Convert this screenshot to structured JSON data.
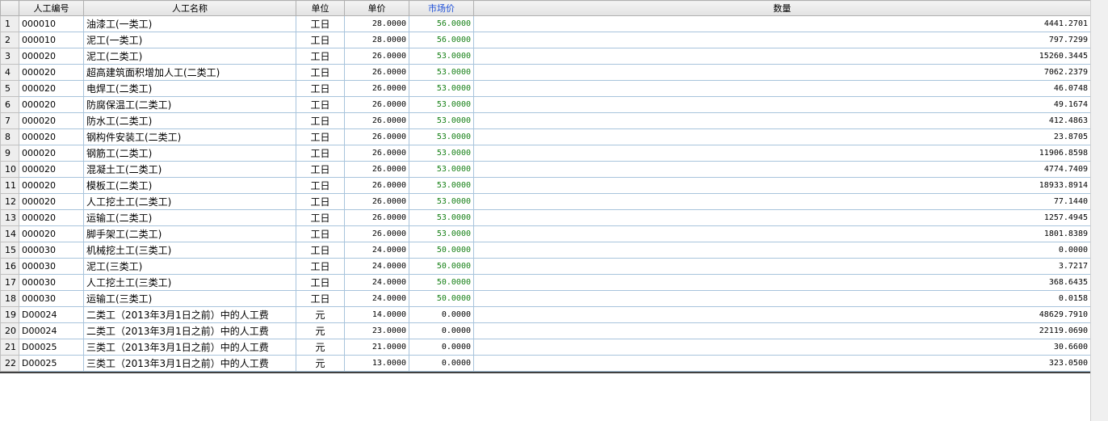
{
  "columns": {
    "rownum": "",
    "code": "人工编号",
    "name": "人工名称",
    "unit": "单位",
    "price": "单价",
    "market_price": "市场价",
    "quantity": "数量"
  },
  "rows": [
    {
      "n": "1",
      "code": "000010",
      "name": "油漆工(一类工)",
      "unit": "工日",
      "price": "28.0000",
      "market": "56.0000",
      "qty": "4441.2701"
    },
    {
      "n": "2",
      "code": "000010",
      "name": "泥工(一类工)",
      "unit": "工日",
      "price": "28.0000",
      "market": "56.0000",
      "qty": "797.7299"
    },
    {
      "n": "3",
      "code": "000020",
      "name": "泥工(二类工)",
      "unit": "工日",
      "price": "26.0000",
      "market": "53.0000",
      "qty": "15260.3445"
    },
    {
      "n": "4",
      "code": "000020",
      "name": "超高建筑面积增加人工(二类工)",
      "unit": "工日",
      "price": "26.0000",
      "market": "53.0000",
      "qty": "7062.2379"
    },
    {
      "n": "5",
      "code": "000020",
      "name": "电焊工(二类工)",
      "unit": "工日",
      "price": "26.0000",
      "market": "53.0000",
      "qty": "46.0748"
    },
    {
      "n": "6",
      "code": "000020",
      "name": "防腐保温工(二类工)",
      "unit": "工日",
      "price": "26.0000",
      "market": "53.0000",
      "qty": "49.1674"
    },
    {
      "n": "7",
      "code": "000020",
      "name": "防水工(二类工)",
      "unit": "工日",
      "price": "26.0000",
      "market": "53.0000",
      "qty": "412.4863"
    },
    {
      "n": "8",
      "code": "000020",
      "name": "钢构件安装工(二类工)",
      "unit": "工日",
      "price": "26.0000",
      "market": "53.0000",
      "qty": "23.8705"
    },
    {
      "n": "9",
      "code": "000020",
      "name": "钢筋工(二类工)",
      "unit": "工日",
      "price": "26.0000",
      "market": "53.0000",
      "qty": "11906.8598"
    },
    {
      "n": "10",
      "code": "000020",
      "name": "混凝土工(二类工)",
      "unit": "工日",
      "price": "26.0000",
      "market": "53.0000",
      "qty": "4774.7409"
    },
    {
      "n": "11",
      "code": "000020",
      "name": "模板工(二类工)",
      "unit": "工日",
      "price": "26.0000",
      "market": "53.0000",
      "qty": "18933.8914"
    },
    {
      "n": "12",
      "code": "000020",
      "name": "人工挖土工(二类工)",
      "unit": "工日",
      "price": "26.0000",
      "market": "53.0000",
      "qty": "77.1440"
    },
    {
      "n": "13",
      "code": "000020",
      "name": "运输工(二类工)",
      "unit": "工日",
      "price": "26.0000",
      "market": "53.0000",
      "qty": "1257.4945"
    },
    {
      "n": "14",
      "code": "000020",
      "name": "脚手架工(二类工)",
      "unit": "工日",
      "price": "26.0000",
      "market": "53.0000",
      "qty": "1801.8389"
    },
    {
      "n": "15",
      "code": "000030",
      "name": "机械挖土工(三类工)",
      "unit": "工日",
      "price": "24.0000",
      "market": "50.0000",
      "qty": "0.0000"
    },
    {
      "n": "16",
      "code": "000030",
      "name": "泥工(三类工)",
      "unit": "工日",
      "price": "24.0000",
      "market": "50.0000",
      "qty": "3.7217"
    },
    {
      "n": "17",
      "code": "000030",
      "name": "人工挖土工(三类工)",
      "unit": "工日",
      "price": "24.0000",
      "market": "50.0000",
      "qty": "368.6435"
    },
    {
      "n": "18",
      "code": "000030",
      "name": "运输工(三类工)",
      "unit": "工日",
      "price": "24.0000",
      "market": "50.0000",
      "qty": "0.0158"
    },
    {
      "n": "19",
      "code": "D00024",
      "name": "二类工（2013年3月1日之前）中的人工费",
      "unit": "元",
      "price": "14.0000",
      "market": "0.0000",
      "qty": "48629.7910"
    },
    {
      "n": "20",
      "code": "D00024",
      "name": "二类工（2013年3月1日之前）中的人工费",
      "unit": "元",
      "price": "23.0000",
      "market": "0.0000",
      "qty": "22119.0690"
    },
    {
      "n": "21",
      "code": "D00025",
      "name": "三类工（2013年3月1日之前）中的人工费",
      "unit": "元",
      "price": "21.0000",
      "market": "0.0000",
      "qty": "30.6600"
    },
    {
      "n": "22",
      "code": "D00025",
      "name": "三类工（2013年3月1日之前）中的人工费",
      "unit": "元",
      "price": "13.0000",
      "market": "0.0000",
      "qty": "323.0500"
    }
  ],
  "colors": {
    "market_header": "#1d4fd8",
    "market_value_green": "#168016",
    "grid_line": "#a8c4dc"
  }
}
